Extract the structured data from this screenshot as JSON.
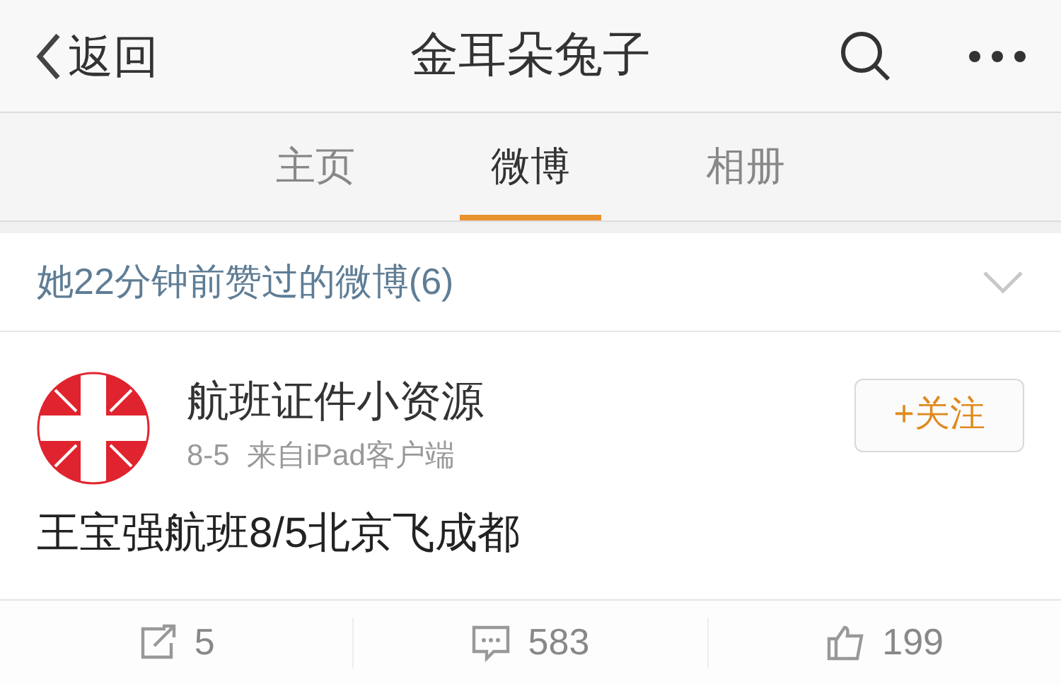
{
  "nav": {
    "back": "返回",
    "title": "金耳朵兔子"
  },
  "tabs": [
    {
      "label": "主页",
      "selected": false
    },
    {
      "label": "微博",
      "selected": true
    },
    {
      "label": "相册",
      "selected": false
    }
  ],
  "liked_header": {
    "text": "她22分钟前赞过的微博(6)",
    "expanded": false
  },
  "post": {
    "author": "航班证件小资源",
    "date": "8-5",
    "source": "来自iPad客户端",
    "follow": "+关注",
    "text": "王宝强航班8/5北京飞成都"
  },
  "actions": [
    {
      "kind": "repost",
      "count": "5"
    },
    {
      "kind": "comment",
      "count": "583"
    },
    {
      "kind": "like",
      "count": "199"
    }
  ]
}
